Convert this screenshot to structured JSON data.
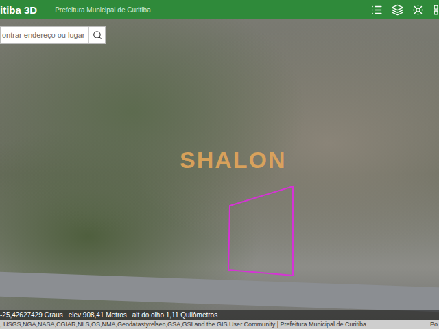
{
  "header": {
    "title": "itiba 3D",
    "subtitle": "Prefeitura Municipal de Curitiba"
  },
  "search": {
    "placeholder": "ontrar endereço ou lugar"
  },
  "watermark": "SHALON",
  "status": {
    "coordinates": "-25,42627429 Graus",
    "elevation": "elev 908,41 Metros",
    "eye_altitude": "alt do olho 1,11 Quilômetros"
  },
  "attribution": ", USGS,NGA,NASA,CGIAR,NLS,OS,NMA,Geodatastyrelsen,GSA,GSI and the GIS User Community | Prefeitura Municipal de Curitiba",
  "attribution_link": "Po"
}
